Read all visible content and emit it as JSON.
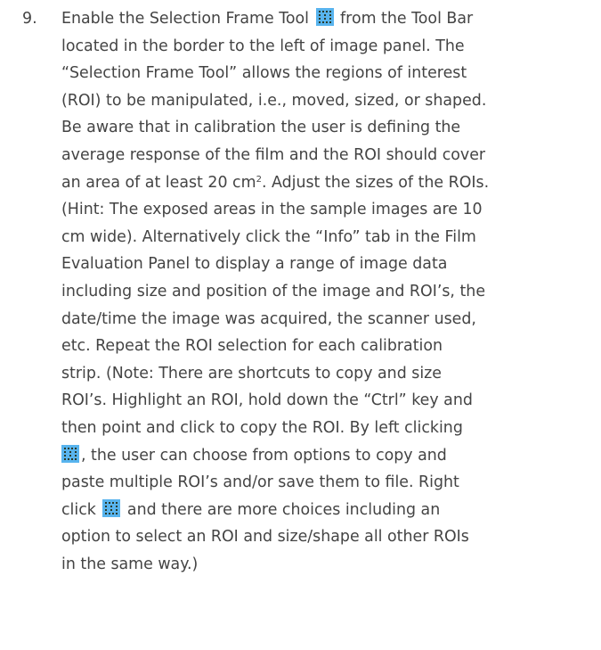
{
  "step": {
    "number": "9.",
    "icon": "selection-frame-tool-icon",
    "lines": [
      {
        "before": "Enable the Selection Frame Tool ",
        "after": " from the Tool Bar"
      },
      {
        "text": "located in the border to the left of image panel. The"
      },
      {
        "text": "“Selection Frame Tool” allows the regions of interest"
      },
      {
        "text": "(ROI) to be manipulated, i.e., moved, sized, or shaped."
      },
      {
        "text": "Be aware that in calibration the user is defining the"
      },
      {
        "text": "average response of the film and the ROI should cover"
      },
      {
        "before": "an area of at least 20 cm",
        "sup": "2",
        "after": ". Adjust the sizes of the ROIs."
      },
      {
        "text": "(Hint: The exposed areas in the sample images are 10"
      },
      {
        "text": "cm wide). Alternatively click the “Info” tab in the Film"
      },
      {
        "text": "Evaluation Panel to display a range of image data"
      },
      {
        "text": "including size and position of the image and ROI’s, the"
      },
      {
        "text": "date/time the image was acquired, the scanner used,"
      },
      {
        "text": "etc. Repeat the ROI selection for each calibration"
      },
      {
        "text": "strip. (Note: There are shortcuts to copy and size"
      },
      {
        "text": "ROI’s. Highlight an ROI, hold down the “Ctrl” key and"
      },
      {
        "text": "then point and click to copy the ROI. By left clicking"
      },
      {
        "before": "",
        "after": ", the user can choose from options to copy and"
      },
      {
        "text": "paste multiple ROI’s and/or save them to file. Right"
      },
      {
        "before": "click ",
        "after": " and there are more choices including an"
      },
      {
        "text": "option to select an ROI and size/shape all other ROIs"
      },
      {
        "text": "in the same way.)"
      }
    ]
  }
}
